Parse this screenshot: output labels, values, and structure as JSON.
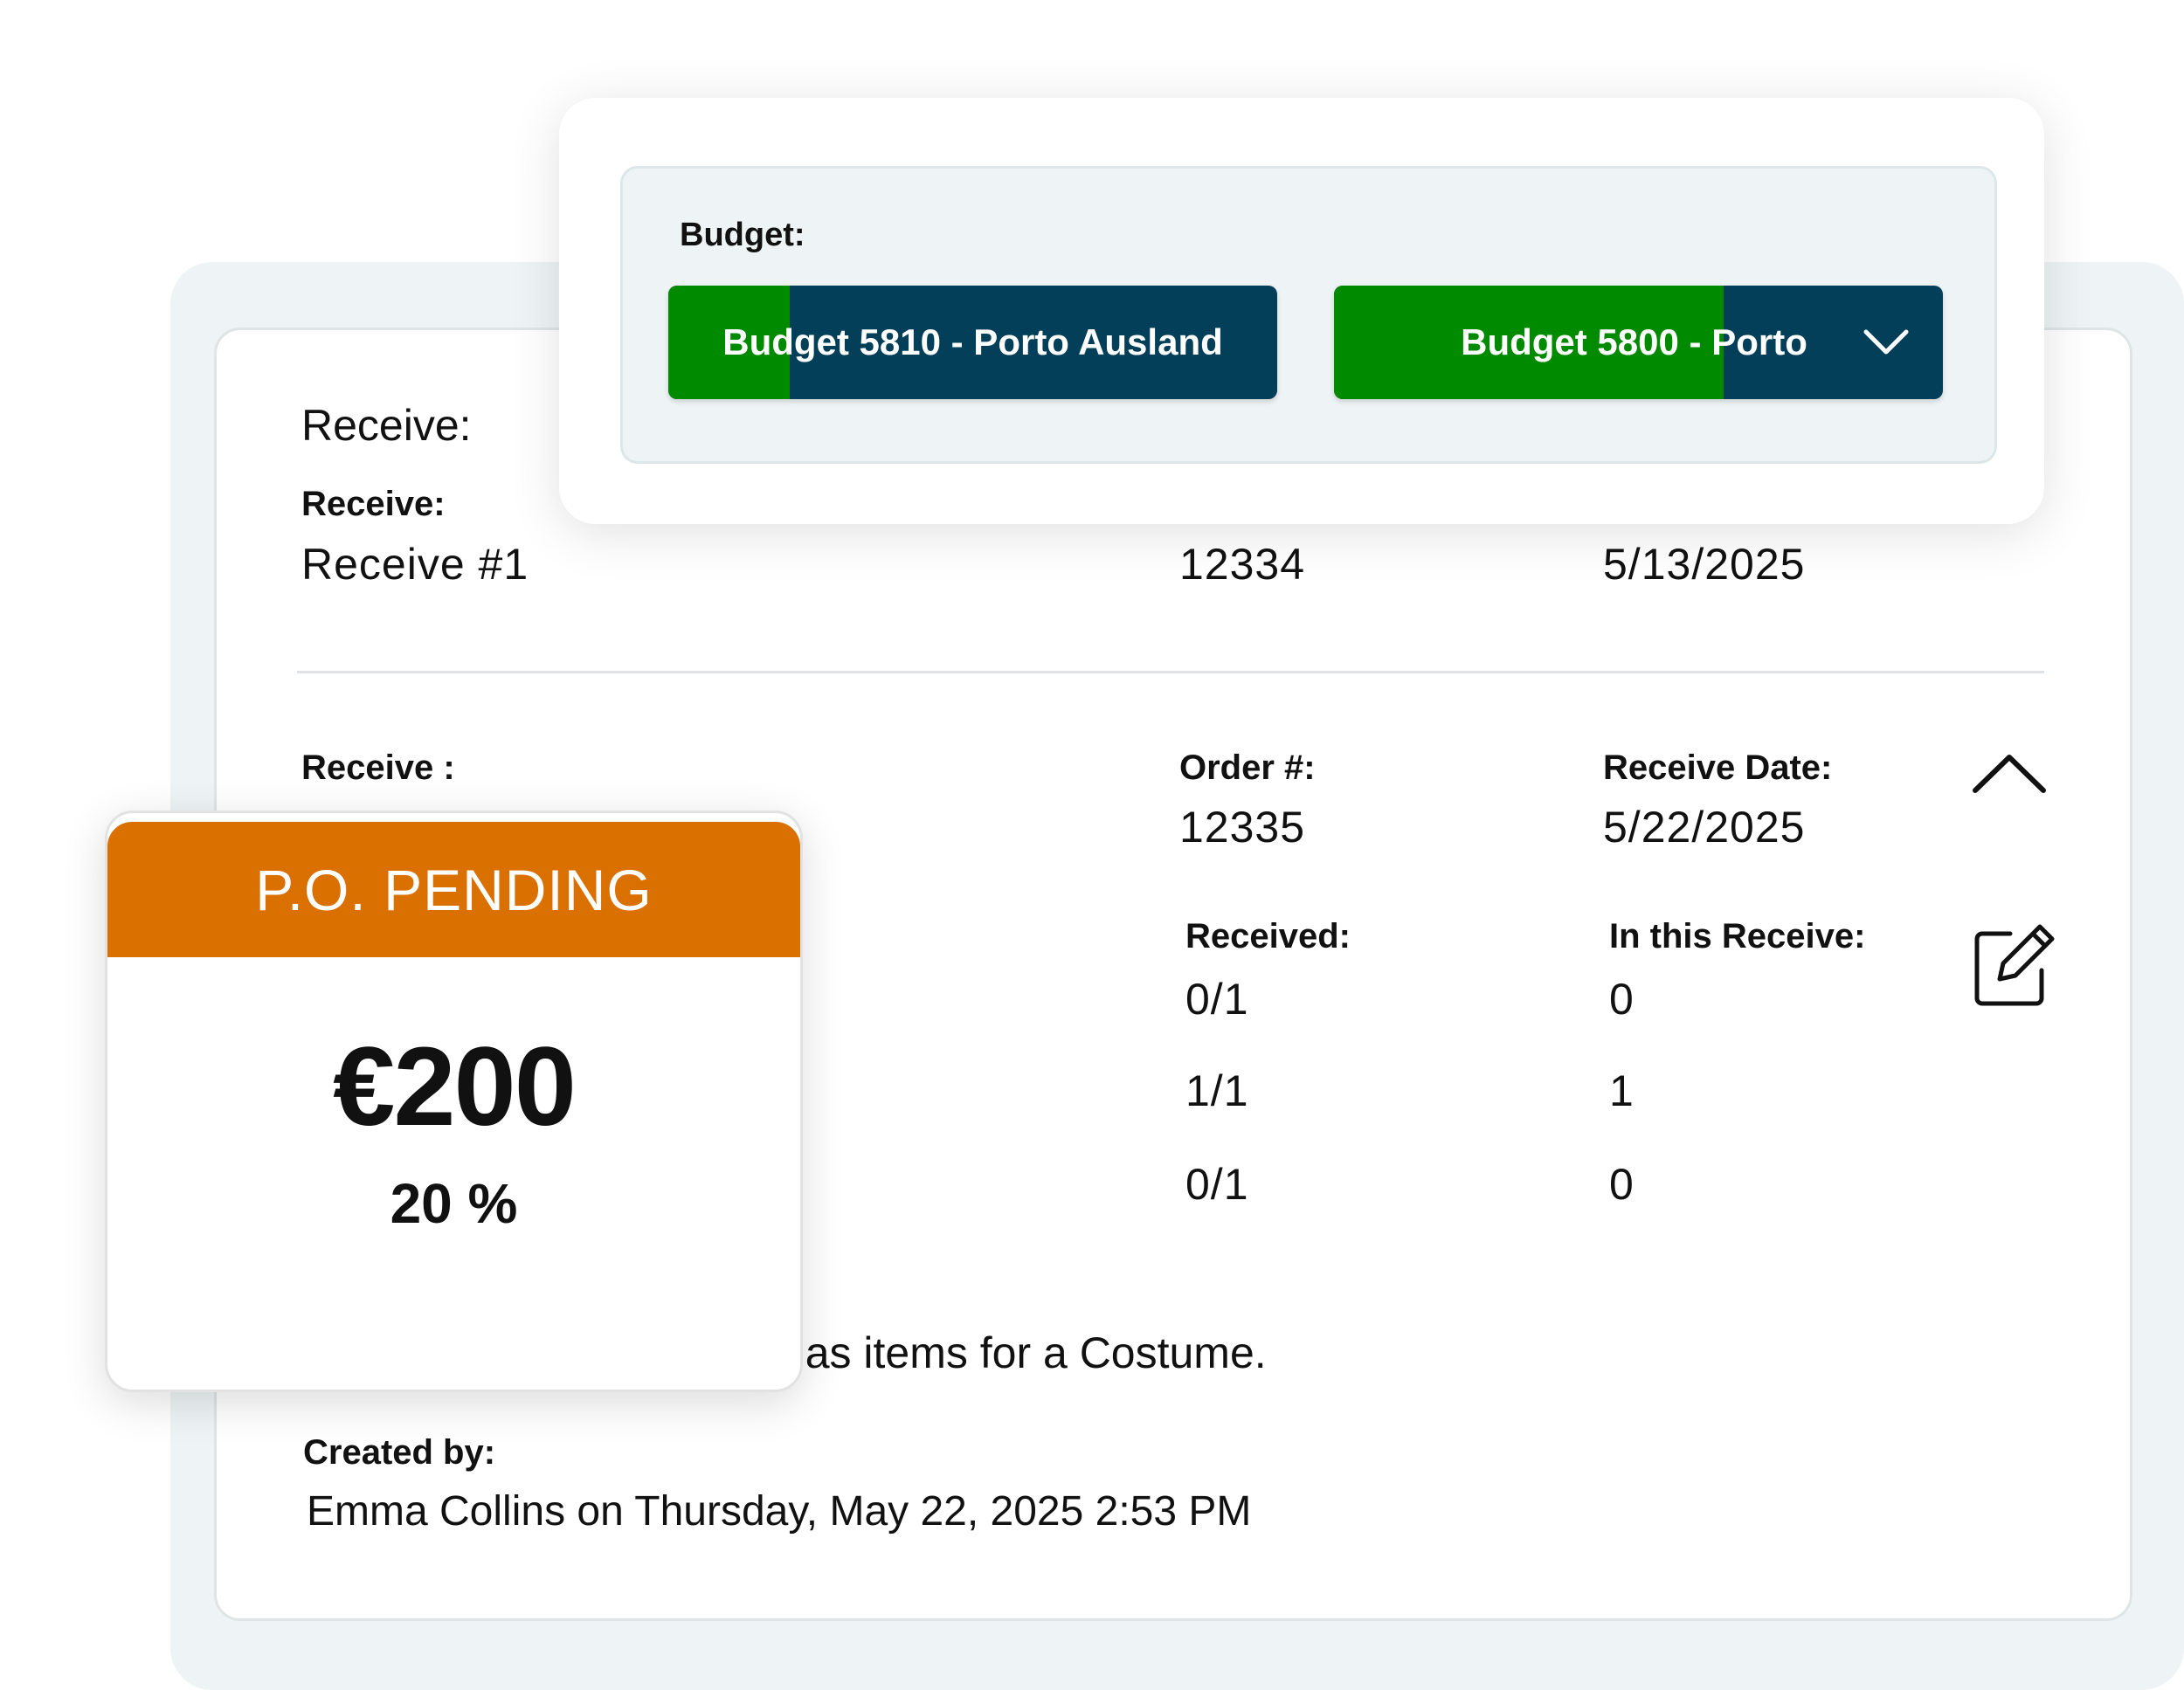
{
  "receive_section": {
    "title": "Receive:",
    "item1": {
      "label": "Receive:",
      "name": "Receive #1",
      "order_number": "12334",
      "receive_date": "5/13/2025"
    },
    "item2": {
      "label": "Receive :",
      "order_label": "Order #:",
      "order_number": "12335",
      "date_label": "Receive Date:",
      "receive_date": "5/22/2025",
      "received_label": "Received:",
      "in_this_receive_label": "In this Receive:",
      "rows": [
        {
          "received": "0/1",
          "in_this": "0"
        },
        {
          "received": "1/1",
          "in_this": "1"
        },
        {
          "received": "0/1",
          "in_this": "0"
        }
      ],
      "description_fragment": "h as items for a Costume.",
      "created_by_label": "Created by:",
      "created_by_value": "Emma Collins on Thursday, May 22, 2025 2:53 PM"
    }
  },
  "budget_popup": {
    "label": "Budget:",
    "buttons": [
      {
        "label": "Budget 5810 - Porto Ausland",
        "fill_fraction": 0.2
      },
      {
        "label": "Budget 5800 - Porto",
        "fill_fraction": 0.64
      }
    ]
  },
  "po_card": {
    "status": "P.O. PENDING",
    "amount": "€200",
    "percent": "20 %"
  },
  "colors": {
    "budget_green": "#008a00",
    "budget_navy": "#043f5a",
    "po_orange": "#d97000",
    "card_bg": "#eef4f5"
  },
  "icons": [
    "chevron-up-icon",
    "edit-icon",
    "chevron-down-icon"
  ]
}
